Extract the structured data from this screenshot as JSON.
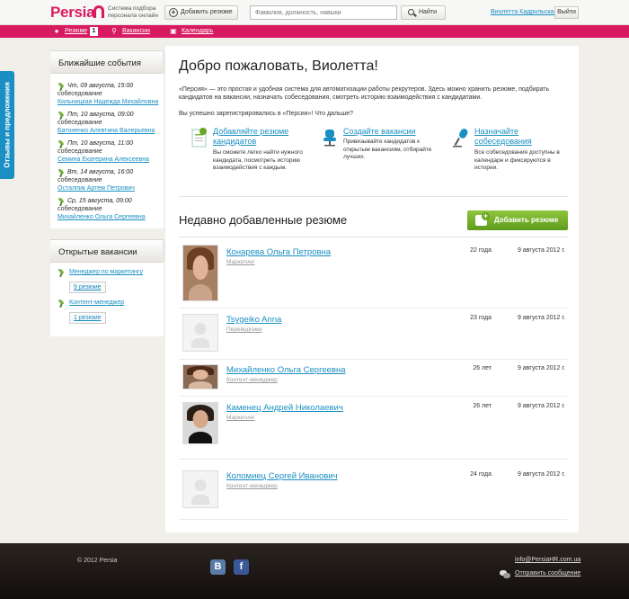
{
  "header": {
    "logo": "Persia",
    "tagline": "Система подбора персонала онлайн",
    "add_resume": "Добавить резюме",
    "search_placeholder": "Фамилия, должность, навыки",
    "search_button": "Найти",
    "user_name": "Виолетта Кадрильская",
    "logout": "Выйти"
  },
  "nav": {
    "resumes": "Резюме",
    "resumes_count": "1",
    "vacancies": "Вакансии",
    "calendar": "Календарь"
  },
  "feedback_tab": "Отзывы и предложения",
  "sidebar": {
    "events_title": "Ближайшие события",
    "events": [
      {
        "date": "Чт, 09 августа, 15:00",
        "type": "собеседование",
        "name": "Кильницкая Надежда Михайловна"
      },
      {
        "date": "Пт, 10 августа, 09:00",
        "type": "собеседование",
        "name": "Батоненко Алевтина Валерьевна"
      },
      {
        "date": "Пт, 10 августа, 11:00",
        "type": "собеседование",
        "name": "Семина Екатерина Алексеевна"
      },
      {
        "date": "Вт, 14 августа, 16:00",
        "type": "собеседование",
        "name": "Осталпик Артем Петрович"
      },
      {
        "date": "Ср, 15 августа, 09:00",
        "type": "собеседование",
        "name": "Михайленко Ольга Сергеевна"
      }
    ],
    "vacancies_title": "Открытые вакансии",
    "vacancies": [
      {
        "title": "Менеджер по маркетингу",
        "count": "9 резюме"
      },
      {
        "title": "Контент-менеджер",
        "count": "1 резюме"
      }
    ]
  },
  "main": {
    "welcome": "Добро пожаловать, Виолетта!",
    "intro": "«Персия» — это простая и удобная система для автоматизации работы рекрутеров. Здесь можно хранить резюме, подбирать кандидатов на вакансии, назначать собеседования, смотреть историю взаимодействия с кандидатами.",
    "next": "Вы успешно зарегистрировались в «Персии»! Что дальше?",
    "features": [
      {
        "title": "Добавляйте резюме кандидатов",
        "text": "Вы сможете легко найти нужного кандидата, посмотреть историю взаимодействия с каждым.",
        "icon": "document-icon"
      },
      {
        "title": "Создайте вакансии",
        "text": "Привязывайте кандидатов к открытым вакансиям, отбирайте лучших.",
        "icon": "chair-icon"
      },
      {
        "title": "Назначайте собеседования",
        "text": "Все собеседования доступны в календаре и фиксируются в истории.",
        "icon": "microphone-icon"
      }
    ],
    "recent_title": "Недавно добавленные резюме",
    "add_button": "Добавить резюме",
    "resumes": [
      {
        "name": "Конарева Ольга Петровна",
        "role": "Маркетинг",
        "age": "22 года",
        "date": "9 августа 2012 г."
      },
      {
        "name": "Tsygeiko Anna",
        "role": "Переводчики",
        "age": "23 года",
        "date": "9 августа 2012 г."
      },
      {
        "name": "Михайленко Ольга Сергеевна",
        "role": "Контент-менеджер",
        "age": "26 лет",
        "date": "9 августа 2012 г."
      },
      {
        "name": "Каменец Андрей Николаевич",
        "role": "Маркетинг",
        "age": "26 лет",
        "date": "9 августа 2012 г."
      },
      {
        "name": "Коломиец Сергей Иванович",
        "role": "Контент-менеджер",
        "age": "24 года",
        "date": "9 августа 2012 г."
      }
    ]
  },
  "footer": {
    "copyright": "© 2012 Persia",
    "email": "info@PersiaHR.com.ua",
    "message": "Отправить сообщение"
  },
  "colors": {
    "brand": "#d81b60",
    "link": "#1a8fc4",
    "accent_green": "#6aa524"
  }
}
